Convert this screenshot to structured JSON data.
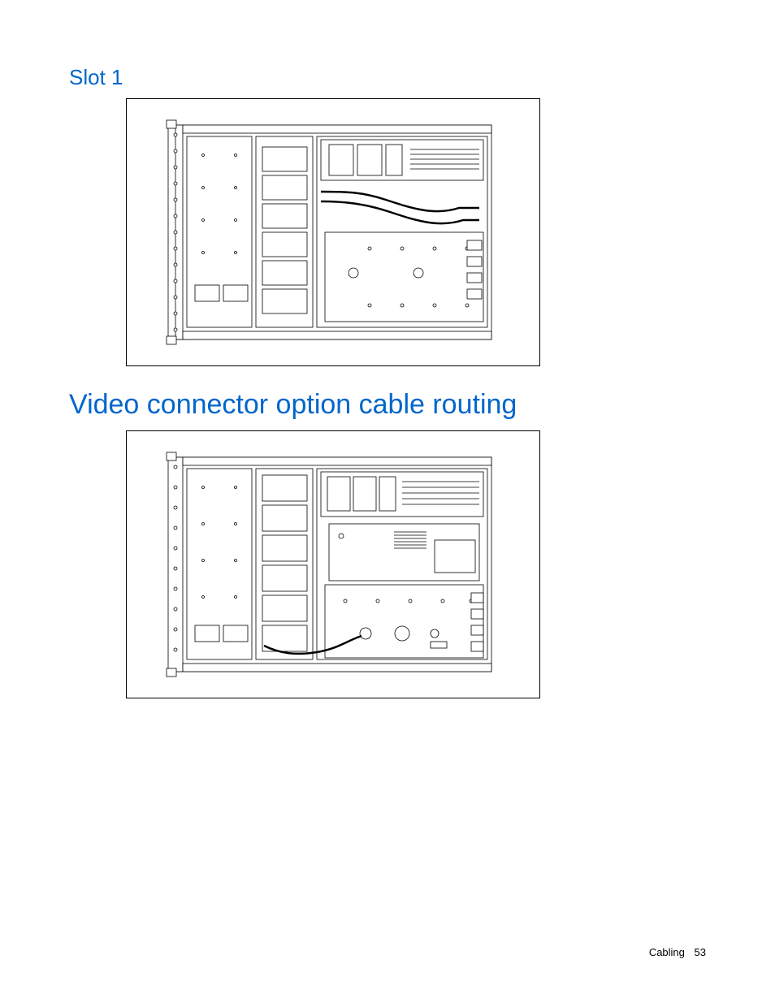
{
  "headings": {
    "slot": "Slot 1",
    "video": "Video connector option cable routing"
  },
  "figures": {
    "slot1_alt": "Technical line drawing: top-down internal view of a server chassis showing Slot 1 cable routing across mainboard, drive bays, expansion slots and power area.",
    "video_alt": "Technical line drawing: top-down internal view of a server chassis showing video connector option cable routing across mainboard, drive bays and expansion area."
  },
  "footer": {
    "section": "Cabling",
    "page": "53"
  }
}
